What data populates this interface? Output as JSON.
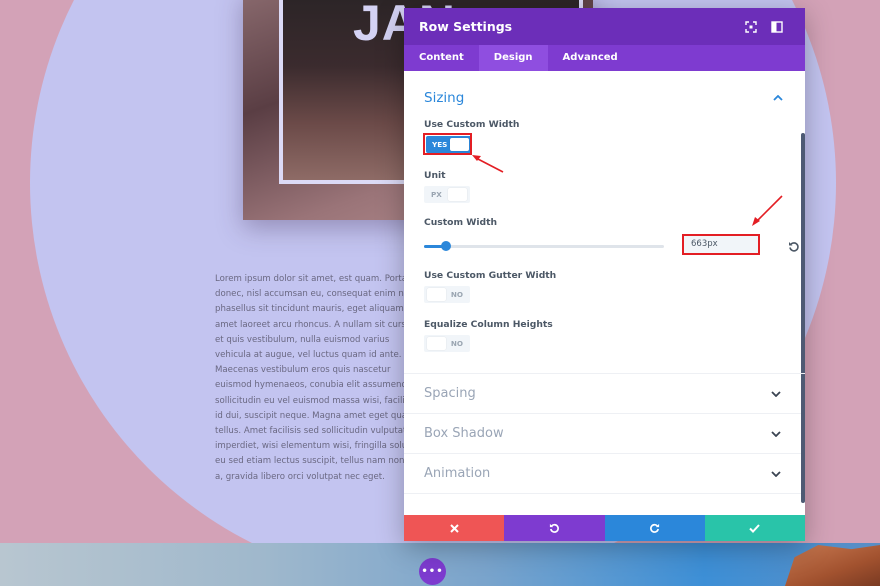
{
  "background": {
    "hero_title": "JAN",
    "lorem_text": "Lorem ipsum dolor sit amet, est quam. Porta\ndonec, nisl accumsan eu, consequat enim non\nphasellus sit tincidunt mauris, eget aliquam\namet laoreet arcu rhoncus. A nullam sit curs\net quis vestibulum, nulla euismod varius\nvehicula at augue, vel luctus quam id ante.\nMaecenas vestibulum eros quis nascetur\neuismod hymenaeos, conubia elit assumenda\nsollicitudin eu vel euismod massa wisi, facilis\nid dui, suscipit neque. Magna amet eget quar\ntellus. Amet facilisis sed sollicitudin vulputat\nimperdiet, wisi elementum wisi, fringilla solu\neu sed etiam lectus suscipit, tellus nam non\na, gravida libero orci volutpat nec eget.",
    "fab_label": "•••"
  },
  "modal": {
    "title": "Row Settings",
    "header_icons": [
      "expand-icon",
      "sidebar-toggle-icon"
    ],
    "tabs": [
      {
        "label": "Content",
        "active": false
      },
      {
        "label": "Design",
        "active": true
      },
      {
        "label": "Advanced",
        "active": false
      }
    ],
    "sections": {
      "sizing": {
        "title": "Sizing",
        "use_custom_width": {
          "label": "Use Custom Width",
          "value": "YES"
        },
        "unit": {
          "label": "Unit",
          "value": "PX"
        },
        "custom_width": {
          "label": "Custom Width",
          "value": "663px",
          "slider_fraction": 0.09
        },
        "use_custom_gutter": {
          "label": "Use Custom Gutter Width",
          "value": "NO"
        },
        "equalize_heights": {
          "label": "Equalize Column Heights",
          "value": "NO"
        }
      },
      "collapsed": [
        {
          "title": "Spacing"
        },
        {
          "title": "Box Shadow"
        },
        {
          "title": "Animation"
        }
      ]
    },
    "footer_buttons": [
      {
        "name": "discard",
        "icon": "close-icon",
        "color": "#ef5555"
      },
      {
        "name": "undo",
        "icon": "undo-icon",
        "color": "#7e3bd0"
      },
      {
        "name": "redo",
        "icon": "redo-icon",
        "color": "#2b87da"
      },
      {
        "name": "save",
        "icon": "check-icon",
        "color": "#29c4a9"
      }
    ]
  },
  "colors": {
    "header": "#6c2eb9",
    "tabs": "#7e3bd0",
    "accent_blue": "#2b87da",
    "annotation_red": "#e31e24"
  }
}
